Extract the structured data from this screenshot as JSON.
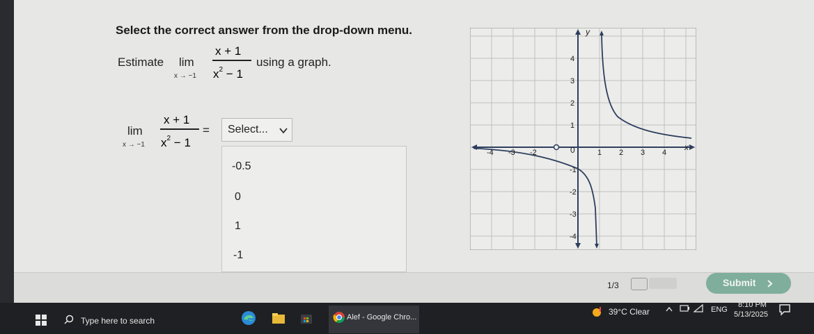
{
  "question": {
    "instruction": "Select the correct answer from the drop-down menu.",
    "estimate_word": "Estimate",
    "lim_word": "lim",
    "lim_sub": "x → −1",
    "numerator": "x + 1",
    "denominator_base": "x",
    "denominator_exp": "2",
    "denominator_rest": "− 1",
    "tail": "using a graph.",
    "answer_lim": "lim",
    "answer_sub": "x → −1",
    "answer_num": "x + 1",
    "answer_den_base": "x",
    "answer_den_exp": "2",
    "answer_den_rest": "− 1",
    "equals": "="
  },
  "select": {
    "label": "Select...",
    "options": [
      "-0.5",
      "0",
      "1",
      "-1"
    ]
  },
  "graph": {
    "y_label": "y",
    "x_label": "x",
    "origin_label": "0",
    "x_ticks": [
      "-4",
      "-3",
      "-2",
      "1",
      "2",
      "3",
      "4"
    ],
    "y_ticks": [
      "4",
      "3",
      "2",
      "1",
      "-1",
      "-2",
      "-3",
      "-4"
    ]
  },
  "footer": {
    "pager": "1/3",
    "submit_label": "Submit"
  },
  "taskbar": {
    "search_placeholder": "Type here to search",
    "chrome_label": "Alef - Google Chro...",
    "weather": "39°C Clear",
    "lang": "ENG",
    "time": "8:10 PM",
    "date": "5/13/2025"
  },
  "colors": {
    "accent": "#7fae9c",
    "curve": "#2d3e5e",
    "grid": "#bfbfbf"
  }
}
